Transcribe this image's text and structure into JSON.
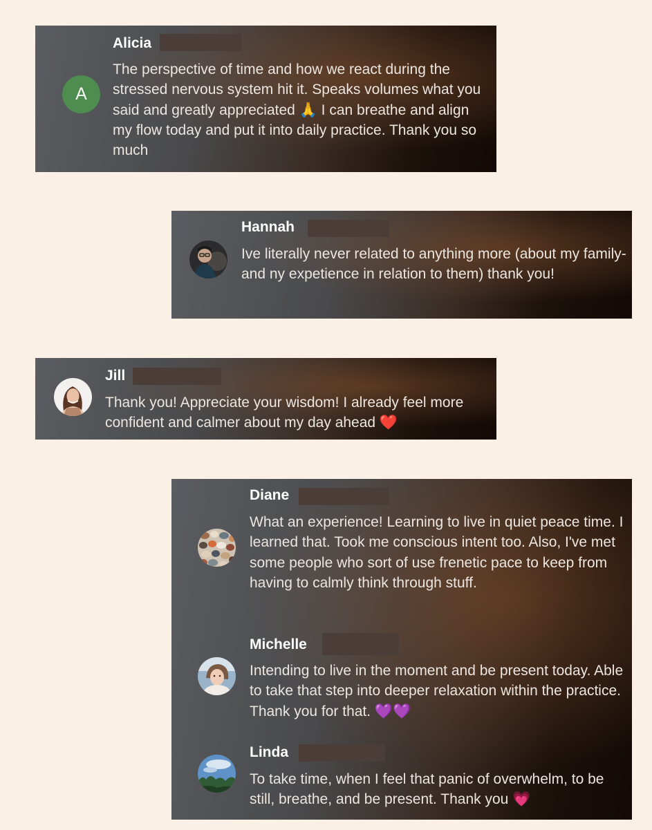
{
  "comments": [
    {
      "name": "Alicia",
      "avatar": {
        "type": "letter",
        "letter": "A",
        "color": "#4e8d4f"
      },
      "text": "The perspective of time and how we react during the stressed nervous system hit it. Speaks volumes what you said and greatly appreciated 🙏 I can breathe and align my flow today and put it into daily practice. Thank you so much"
    },
    {
      "name": "Hannah",
      "avatar": {
        "type": "photo",
        "icon": "person-photo-icon"
      },
      "text": "Ive literally never related to anything more (about my family- and ny expetience in relation to them) thank you!"
    },
    {
      "name": "Jill",
      "avatar": {
        "type": "photo",
        "icon": "person-photo-icon"
      },
      "text": "Thank you! Appreciate your wisdom! I already feel more confident and calmer about my day ahead ❤️"
    },
    {
      "name": "Diane",
      "avatar": {
        "type": "photo",
        "icon": "pebbles-photo-icon"
      },
      "text": "What an experience! Learning to live in quiet peace time. I learned that. Took me conscious intent too. Also, I've met some people who sort of use frenetic pace to keep from having to calmly think through stuff."
    },
    {
      "name": "Michelle",
      "avatar": {
        "type": "photo",
        "icon": "person-photo-icon"
      },
      "text": "Intending to live in the moment and be present today. Able to take that step into deeper relaxation within the practice. Thank you for that. 💜💜"
    },
    {
      "name": "Linda",
      "avatar": {
        "type": "photo",
        "icon": "sky-trees-photo-icon"
      },
      "text": "To take time, when I feel that panic of overwhelm, to be still, breathe, and be present. Thank you 💗"
    }
  ],
  "colors": {
    "page_background": "#faf0e6",
    "card_gradient_start": "#5a5d61",
    "card_gradient_end": "#120a06",
    "redaction": "#4b3e39"
  }
}
